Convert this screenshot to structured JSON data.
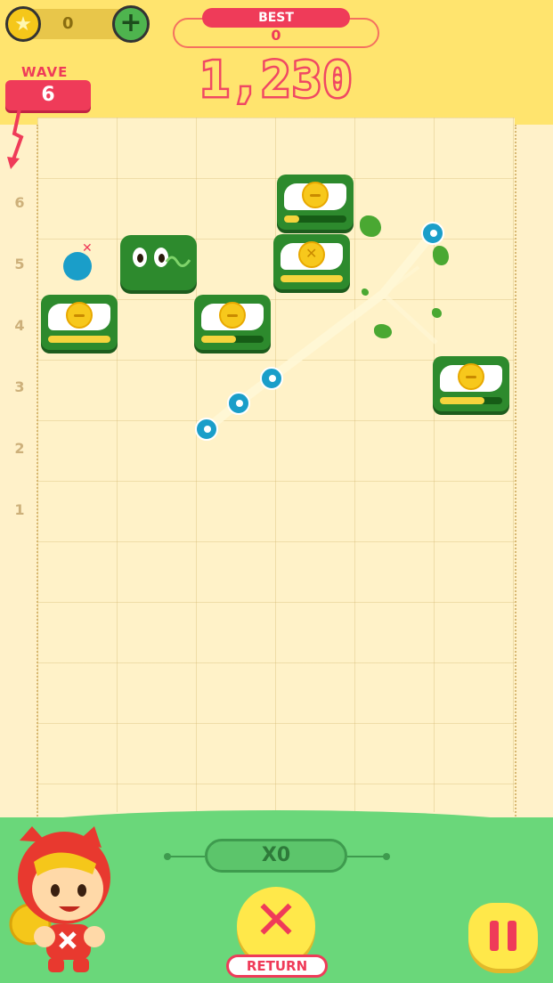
{
  "header": {
    "coins": "0",
    "best_label": "BEST",
    "best_value": "0",
    "score": "1,230",
    "wave_label": "WAVE",
    "wave_value": "6"
  },
  "row_labels": [
    "6",
    "5",
    "4",
    "3",
    "2",
    "1"
  ],
  "footer": {
    "multiplier": "X0",
    "return_label": "RETURN"
  },
  "colors": {
    "accent": "#ef3b59",
    "header_bg": "#ffe46e",
    "footer_bg": "#6ad77a",
    "block_green": "#2d8a2d",
    "ball_blue": "#1a9ec9"
  }
}
